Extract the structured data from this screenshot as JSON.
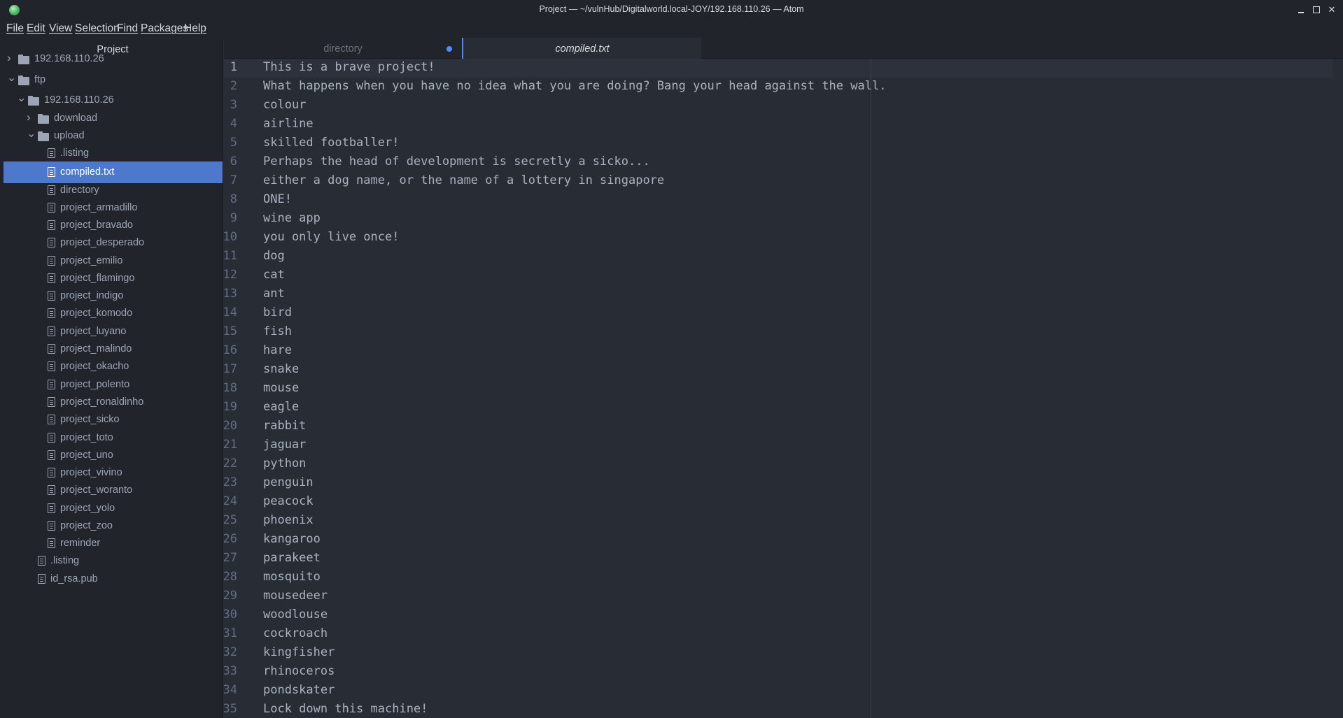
{
  "window": {
    "title": "Project — ~/vulnHub/Digitalworld.local-JOY/192.168.110.26 — Atom",
    "minimize_glyph": "",
    "close_glyph": "✕"
  },
  "menu": [
    "File",
    "Edit",
    "View",
    "Selection",
    "Find",
    "Packages",
    "Help"
  ],
  "sidebar": {
    "title": "Project",
    "tree": [
      {
        "label": "192.168.110.26",
        "type": "folder",
        "expanded": false
      },
      {
        "label": "ftp",
        "type": "folder",
        "expanded": true
      },
      {
        "label": "192.168.110.26",
        "type": "folder",
        "expanded": true
      },
      {
        "label": "download",
        "type": "folder",
        "expanded": false
      },
      {
        "label": "upload",
        "type": "folder",
        "expanded": true
      },
      {
        "label": ".listing",
        "type": "file"
      },
      {
        "label": "compiled.txt",
        "type": "file",
        "selected": true
      },
      {
        "label": "directory",
        "type": "file"
      },
      {
        "label": "project_armadillo",
        "type": "file"
      },
      {
        "label": "project_bravado",
        "type": "file"
      },
      {
        "label": "project_desperado",
        "type": "file"
      },
      {
        "label": "project_emilio",
        "type": "file"
      },
      {
        "label": "project_flamingo",
        "type": "file"
      },
      {
        "label": "project_indigo",
        "type": "file"
      },
      {
        "label": "project_komodo",
        "type": "file"
      },
      {
        "label": "project_luyano",
        "type": "file"
      },
      {
        "label": "project_malindo",
        "type": "file"
      },
      {
        "label": "project_okacho",
        "type": "file"
      },
      {
        "label": "project_polento",
        "type": "file"
      },
      {
        "label": "project_ronaldinho",
        "type": "file"
      },
      {
        "label": "project_sicko",
        "type": "file"
      },
      {
        "label": "project_toto",
        "type": "file"
      },
      {
        "label": "project_uno",
        "type": "file"
      },
      {
        "label": "project_vivino",
        "type": "file"
      },
      {
        "label": "project_woranto",
        "type": "file"
      },
      {
        "label": "project_yolo",
        "type": "file"
      },
      {
        "label": "project_zoo",
        "type": "file"
      },
      {
        "label": "reminder",
        "type": "file"
      },
      {
        "label": ".listing",
        "type": "file"
      },
      {
        "label": "id_rsa.pub",
        "type": "file"
      }
    ]
  },
  "tabs": [
    {
      "label": "directory",
      "modified": true,
      "active": false
    },
    {
      "label": "compiled.txt",
      "modified": false,
      "active": true
    }
  ],
  "editor": {
    "lines": [
      "This is a brave project!",
      "What happens when you have no idea what you are doing? Bang your head against the wall.",
      "colour",
      "airline",
      "skilled footballer!",
      "Perhaps the head of development is secretly a sicko...",
      "either a dog name, or the name of a lottery in singapore",
      "ONE!",
      "wine app",
      "you only live once!",
      "dog",
      "cat",
      "ant",
      "bird",
      "fish",
      "hare",
      "snake",
      "mouse",
      "eagle",
      "rabbit",
      "jaguar",
      "python",
      "penguin",
      "peacock",
      "phoenix",
      "kangaroo",
      "parakeet",
      "mosquito",
      "mousedeer",
      "woodlouse",
      "cockroach",
      "kingfisher",
      "rhinoceros",
      "pondskater",
      "Lock down this machine!"
    ]
  },
  "colors": {
    "accent": "#4d78cc",
    "modified_dot": "#528bff",
    "bg_panel": "#21252b",
    "bg_editor": "#282c34"
  }
}
